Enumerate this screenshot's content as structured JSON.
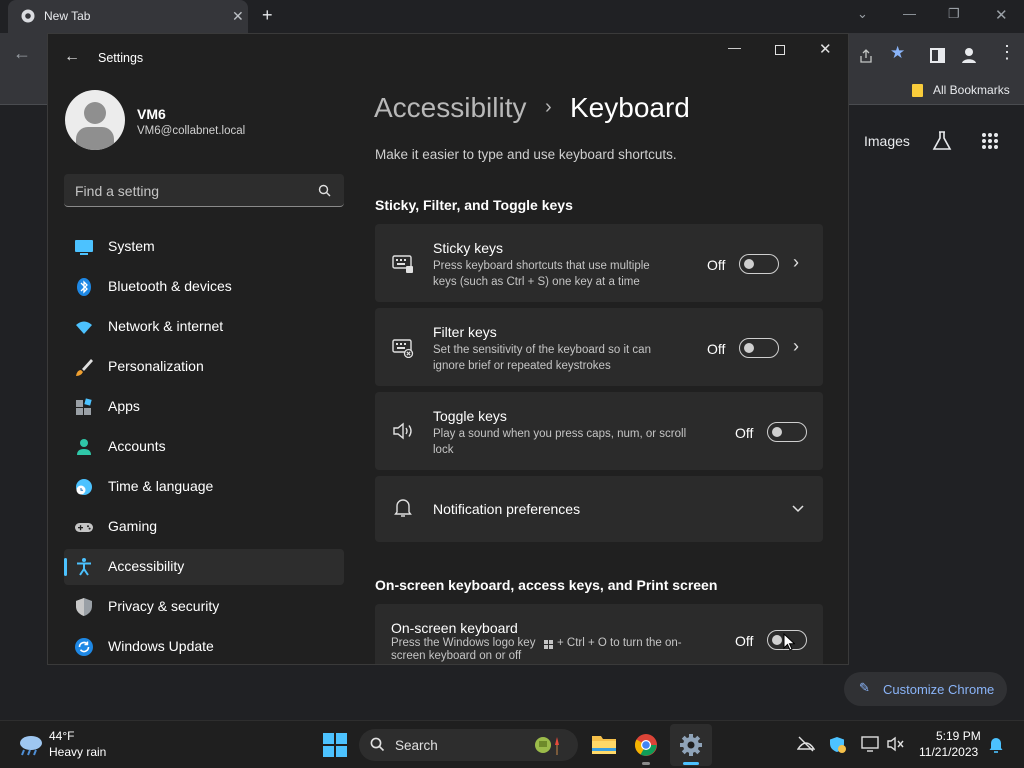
{
  "browser": {
    "tab_title": "New Tab",
    "bookmarks_label": "All Bookmarks",
    "images_link": "Images",
    "customize_label": "Customize Chrome"
  },
  "settings": {
    "app_title": "Settings",
    "user": {
      "name": "VM6",
      "email": "VM6@collabnet.local"
    },
    "search_placeholder": "Find a setting",
    "nav": [
      {
        "label": "System",
        "icon": "monitor-icon"
      },
      {
        "label": "Bluetooth & devices",
        "icon": "bluetooth-icon"
      },
      {
        "label": "Network & internet",
        "icon": "wifi-icon"
      },
      {
        "label": "Personalization",
        "icon": "brush-icon"
      },
      {
        "label": "Apps",
        "icon": "apps-icon"
      },
      {
        "label": "Accounts",
        "icon": "person-icon"
      },
      {
        "label": "Time & language",
        "icon": "globe-clock-icon"
      },
      {
        "label": "Gaming",
        "icon": "gamepad-icon"
      },
      {
        "label": "Accessibility",
        "icon": "accessibility-icon",
        "active": true
      },
      {
        "label": "Privacy & security",
        "icon": "shield-icon"
      },
      {
        "label": "Windows Update",
        "icon": "update-icon"
      }
    ],
    "breadcrumb_parent": "Accessibility",
    "breadcrumb_sep": "›",
    "page_title": "Keyboard",
    "page_subtitle": "Make it easier to type and use keyboard shortcuts.",
    "section1": "Sticky, Filter, and Toggle keys",
    "sticky": {
      "title": "Sticky keys",
      "desc1": "Press keyboard shortcuts that use multiple",
      "desc2": "keys (such as Ctrl + S) one key at a time",
      "state": "Off"
    },
    "filter": {
      "title": "Filter keys",
      "desc1": "Set the sensitivity of the keyboard so it can",
      "desc2": "ignore brief or repeated keystrokes",
      "state": "Off"
    },
    "toggle": {
      "title": "Toggle keys",
      "desc1": "Play a sound when you press caps, num, or scroll",
      "desc2": "lock",
      "state": "Off"
    },
    "notif": {
      "title": "Notification preferences"
    },
    "section2": "On-screen keyboard, access keys, and Print screen",
    "osk": {
      "title": "On-screen keyboard",
      "desc1": "Press the Windows logo key",
      "desc1b": "+ Ctrl + O to turn the on-",
      "desc2": "screen keyboard on or off",
      "state": "Off"
    }
  },
  "taskbar": {
    "weather_temp": "44°F",
    "weather_desc": "Heavy rain",
    "search_label": "Search",
    "time": "5:19 PM",
    "date": "11/21/2023"
  },
  "colors": {
    "accent": "#4cc2ff",
    "window_bg": "#202020",
    "card_bg": "#2b2b2b"
  }
}
